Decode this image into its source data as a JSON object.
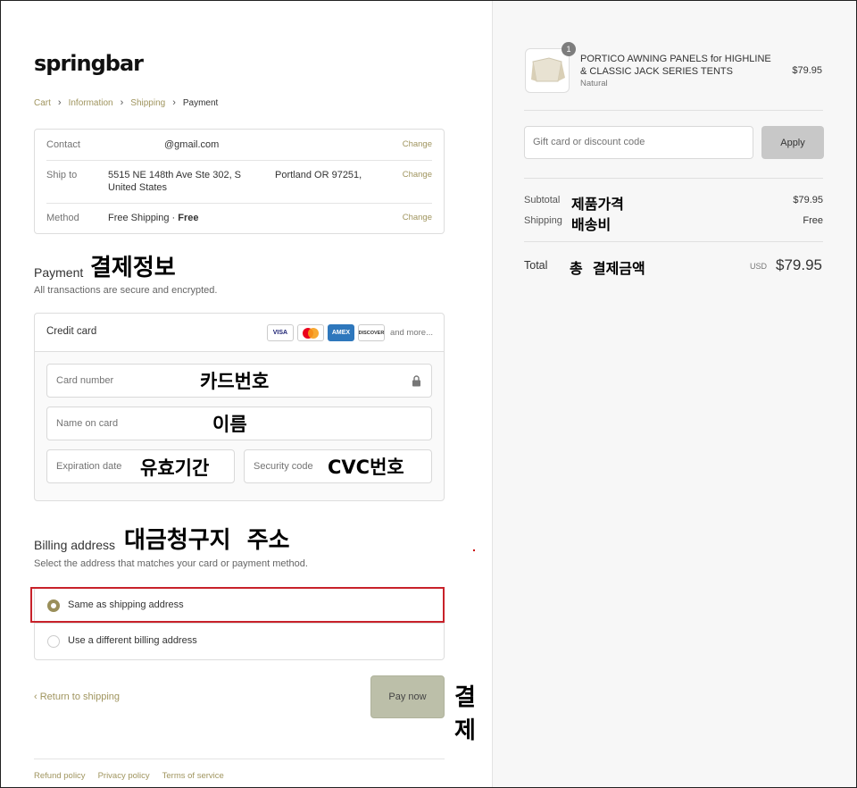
{
  "brand": {
    "logo_text": "springbar"
  },
  "breadcrumb": {
    "items": [
      "Cart",
      "Information",
      "Shipping",
      "Payment"
    ],
    "separator": "›"
  },
  "review": {
    "contact": {
      "label": "Contact",
      "value": "@gmail.com",
      "change": "Change"
    },
    "ship_to": {
      "label": "Ship to",
      "line1": "5515 NE 148th Ave Ste 302, S",
      "line2": "United States",
      "city": "Portland OR 97251,",
      "change": "Change"
    },
    "method": {
      "label": "Method",
      "value": "Free Shipping · ",
      "value_bold": "Free",
      "change": "Change"
    }
  },
  "payment": {
    "title": "Payment",
    "subtitle": "All transactions are secure and encrypted.",
    "method_label": "Credit card",
    "card_brands": [
      "VISA",
      "MC",
      "AMEX",
      "DISCOVER"
    ],
    "and_more": "and more...",
    "fields": {
      "card_number": "Card number",
      "name_on_card": "Name on card",
      "expiration": "Expiration date",
      "security": "Security code"
    }
  },
  "billing": {
    "title": "Billing address",
    "subtitle": "Select the address that matches your card or payment method.",
    "options": [
      "Same as shipping address",
      "Use a different billing address"
    ],
    "selected": 0
  },
  "actions": {
    "return": "‹ Return to shipping",
    "pay_now": "Pay now"
  },
  "footer": [
    "Refund policy",
    "Privacy policy",
    "Terms of service"
  ],
  "annotations": {
    "payment_info": "결제정보",
    "card_number": "카드번호",
    "name": "이름",
    "expiry": "유효기간",
    "cvc": "CVC번호",
    "billing": "대금청구지  주소",
    "pay": "결제",
    "product_price": "제품가격",
    "shipping_fee": "배송비",
    "total_amount": "총  결제금액"
  },
  "summary": {
    "item": {
      "quantity": "1",
      "name": "PORTICO AWNING PANELS for HIGHLINE & CLASSIC JACK SERIES TENTS",
      "variant": "Natural",
      "price": "$79.95"
    },
    "gift_placeholder": "Gift card or discount code",
    "apply": "Apply",
    "subtotal_label": "Subtotal",
    "subtotal_value": "$79.95",
    "shipping_label": "Shipping",
    "shipping_value": "Free",
    "total_label": "Total",
    "total_currency": "USD",
    "total_value": "$79.95"
  },
  "colors": {
    "accent": "#a0955f",
    "highlight_border": "#c8222a",
    "pay_button": "#bcbfa9"
  }
}
